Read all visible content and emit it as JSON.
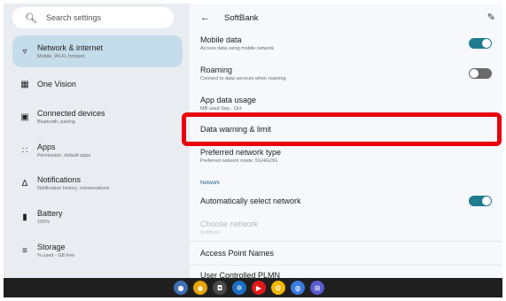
{
  "search": {
    "placeholder": "Search settings",
    "icon": "search-icon"
  },
  "sidebar": {
    "items": [
      {
        "title": "Network & internet",
        "subtitle": "Mobile, Wi-Fi, hotspot",
        "icon": "wifi-icon",
        "selected": true
      },
      {
        "title": "One Vision",
        "subtitle": "",
        "icon": "one-vision-icon"
      },
      {
        "title": "Connected devices",
        "subtitle": "Bluetooth, pairing",
        "icon": "devices-icon"
      },
      {
        "title": "Apps",
        "subtitle": "Permission, default apps",
        "icon": "apps-icon"
      },
      {
        "title": "Notifications",
        "subtitle": "Notification history, conversations",
        "icon": "bell-icon"
      },
      {
        "title": "Battery",
        "subtitle": "100%",
        "icon": "battery-icon"
      },
      {
        "title": "Storage",
        "subtitle": "% used - GB free",
        "icon": "storage-icon"
      }
    ]
  },
  "header": {
    "title": "SoftBank"
  },
  "settings": {
    "mobile_data": {
      "title": "Mobile data",
      "subtitle": "Access data using mobile network",
      "enabled": true
    },
    "roaming": {
      "title": "Roaming",
      "subtitle": "Connect to data services when roaming",
      "enabled": false
    },
    "app_data_usage": {
      "title": "App data usage",
      "subtitle": "MB used Sep - Oct"
    },
    "data_warning": {
      "title": "Data warning & limit"
    },
    "preferred_network": {
      "title": "Preferred network type",
      "subtitle": "Preferred network mode: 5G/4G/3G"
    },
    "network_category": "Network",
    "auto_select": {
      "title": "Automatically select network",
      "enabled": true
    },
    "choose_network": {
      "title": "Choose network",
      "subtitle": "SoftBank"
    },
    "apn": {
      "title": "Access Point Names"
    },
    "user_plmn": {
      "title": "User Controlled PLMN"
    }
  },
  "colors": {
    "accent_toggle": "#1f7b8f",
    "selected_nav": "#c5dcea",
    "highlight": "#e8000b"
  },
  "taskbar": {
    "apps": [
      {
        "name": "launcher",
        "color": "#3f6fb5",
        "glyph": "●"
      },
      {
        "name": "chrome",
        "color": "#e8a300",
        "glyph": "◉"
      },
      {
        "name": "camera",
        "color": "#4a4a4a",
        "glyph": "◘"
      },
      {
        "name": "settings",
        "color": "#1a6fc2",
        "glyph": "✲"
      },
      {
        "name": "youtube",
        "color": "#e01a1a",
        "glyph": "▶"
      },
      {
        "name": "photos",
        "color": "#f2b705",
        "glyph": "✿"
      },
      {
        "name": "assistant",
        "color": "#3a7be0",
        "glyph": "◍"
      },
      {
        "name": "apps-folder",
        "color": "#5a5ad0",
        "glyph": "⊞"
      }
    ]
  }
}
